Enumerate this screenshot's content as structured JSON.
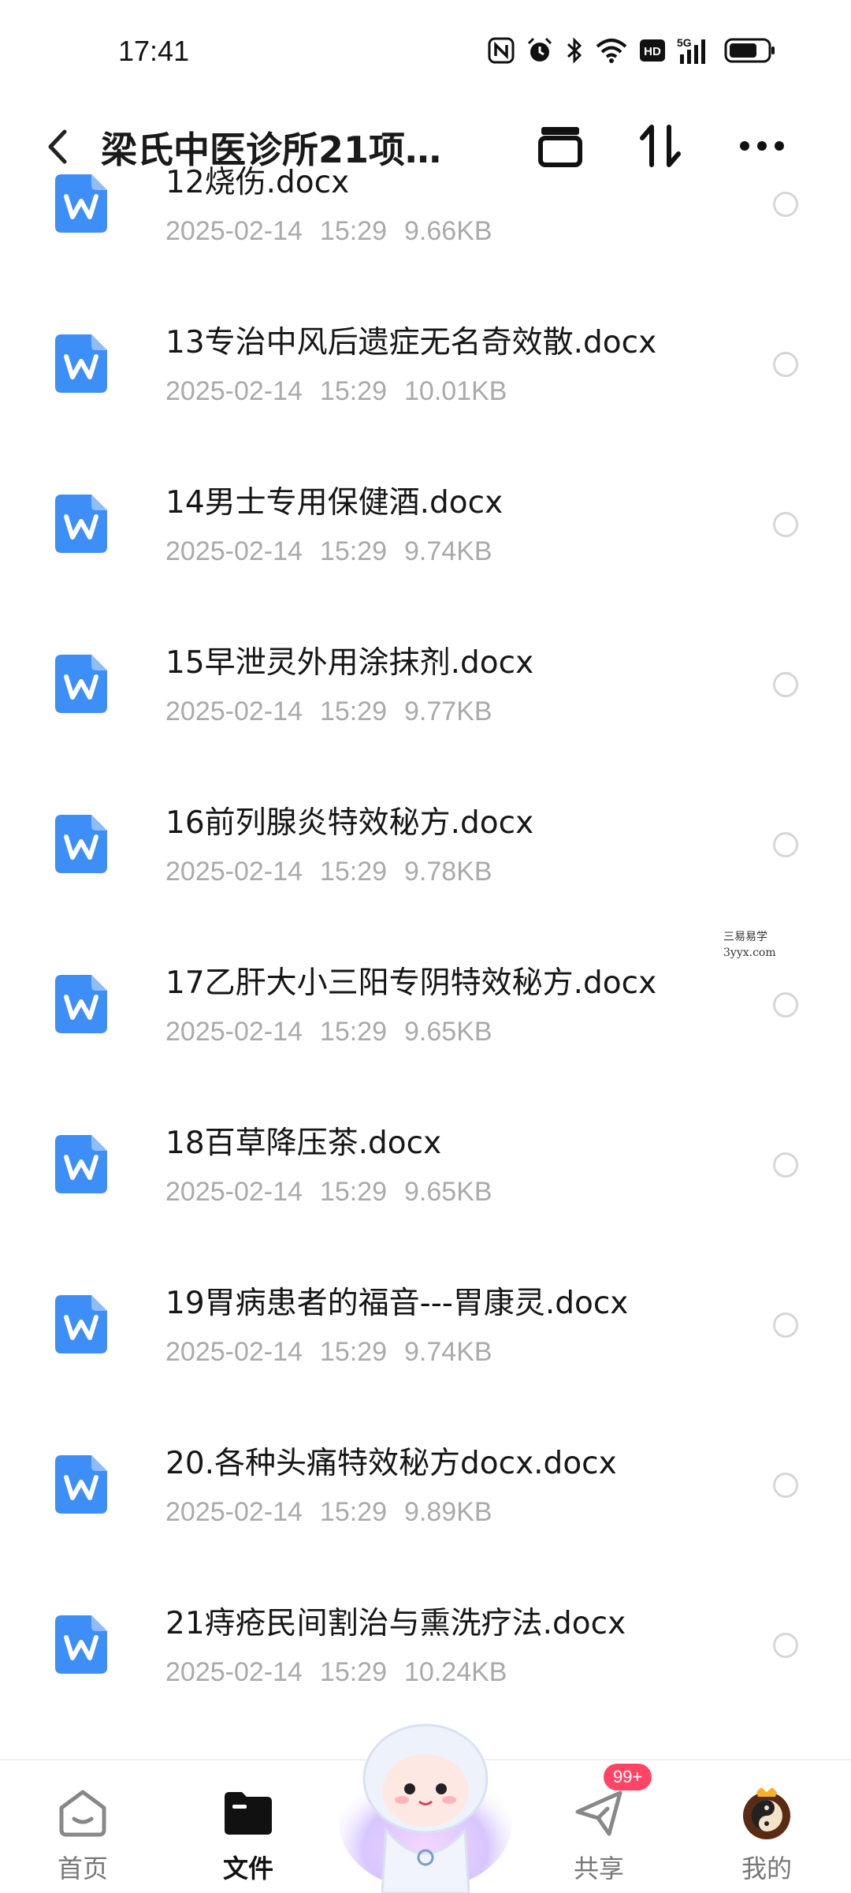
{
  "status_bar": {
    "time": "17:41",
    "icons": [
      "nfc-icon",
      "alarm-icon",
      "bluetooth-icon",
      "wifi-icon",
      "hd-icon",
      "signal-5g-icon",
      "battery-icon"
    ],
    "hd_label": "HD",
    "net_label": "5G"
  },
  "header": {
    "title": "梁氏中医诊所21项…",
    "actions": [
      "select-mode-icon",
      "sort-icon",
      "more-icon"
    ]
  },
  "files": [
    {
      "name": "12烧伤.docx",
      "date": "2025-02-14",
      "time": "15:29",
      "size": "9.66KB"
    },
    {
      "name": "13专治中风后遗症无名奇效散.docx",
      "date": "2025-02-14",
      "time": "15:29",
      "size": "10.01KB"
    },
    {
      "name": "14男士专用保健酒.docx",
      "date": "2025-02-14",
      "time": "15:29",
      "size": "9.74KB"
    },
    {
      "name": "15早泄灵外用涂抹剂.docx",
      "date": "2025-02-14",
      "time": "15:29",
      "size": "9.77KB"
    },
    {
      "name": "16前列腺炎特效秘方.docx",
      "date": "2025-02-14",
      "time": "15:29",
      "size": "9.78KB"
    },
    {
      "name": "17乙肝大小三阳专阴特效秘方.docx",
      "date": "2025-02-14",
      "time": "15:29",
      "size": "9.65KB"
    },
    {
      "name": "18百草降压茶.docx",
      "date": "2025-02-14",
      "time": "15:29",
      "size": "9.65KB"
    },
    {
      "name": "19胃病患者的福音---胃康灵.docx",
      "date": "2025-02-14",
      "time": "15:29",
      "size": "9.74KB"
    },
    {
      "name": "20.各种头痛特效秘方docx.docx",
      "date": "2025-02-14",
      "time": "15:29",
      "size": "9.89KB"
    },
    {
      "name": "21痔疮民间割治与熏洗疗法.docx",
      "date": "2025-02-14",
      "time": "15:29",
      "size": "10.24KB"
    }
  ],
  "watermark": {
    "line1": "三易易学",
    "line2": "3yyx.com"
  },
  "bottom_nav": {
    "home": "首页",
    "files": "文件",
    "share": "共享",
    "share_badge": "99+",
    "mine": "我的"
  },
  "colors": {
    "accent": "#3a8bf5",
    "doc_icon": "#3d8ef7"
  }
}
